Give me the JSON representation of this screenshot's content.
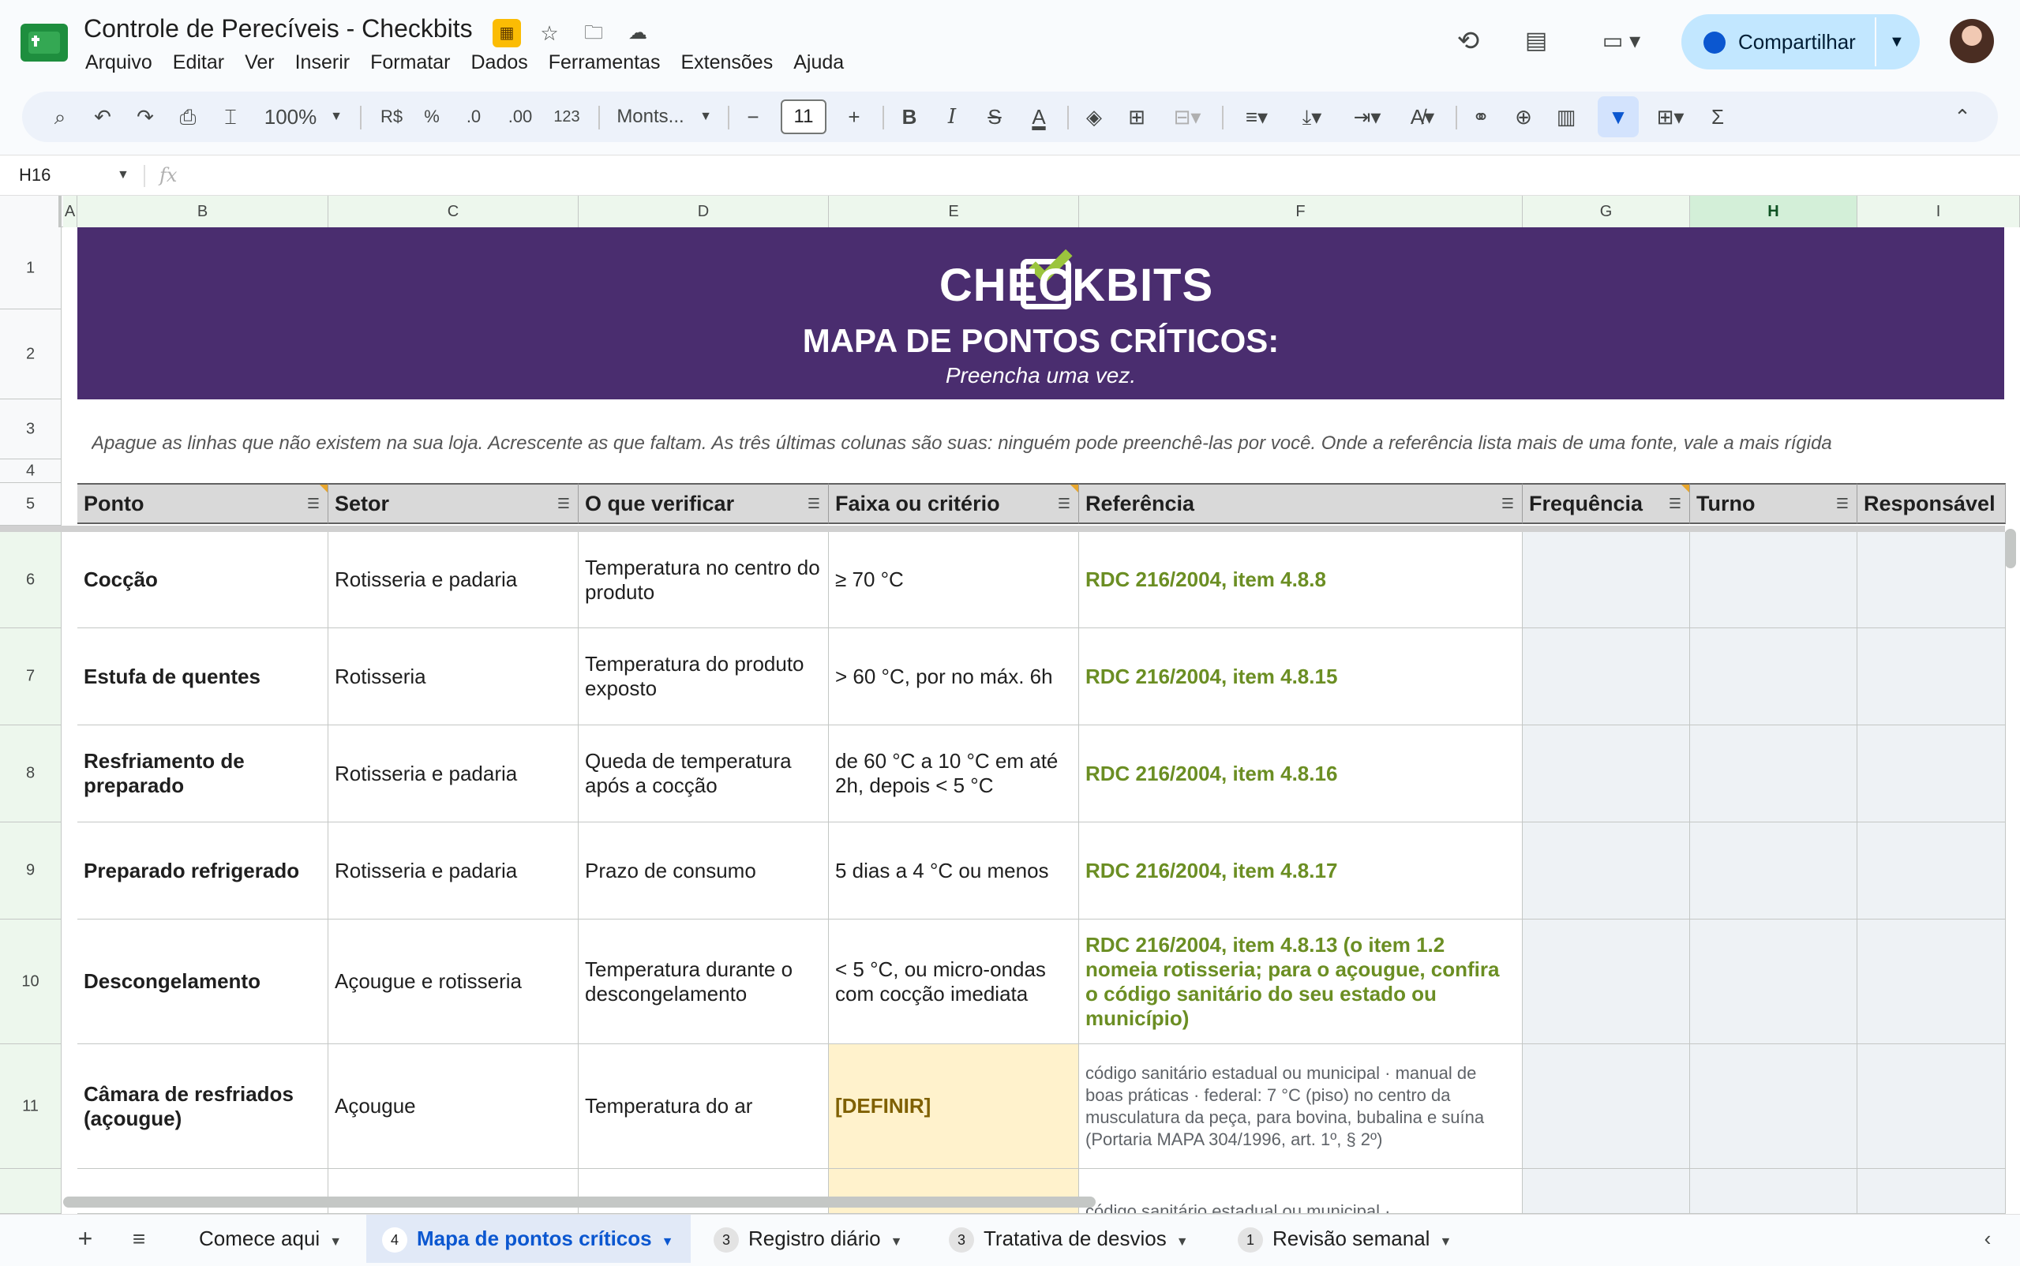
{
  "app": {
    "doc_title": "Controle de Perecíveis - Checkbits",
    "menus": [
      "Arquivo",
      "Editar",
      "Ver",
      "Inserir",
      "Formatar",
      "Dados",
      "Ferramentas",
      "Extensões",
      "Ajuda"
    ],
    "share_label": "Compartilhar"
  },
  "toolbar": {
    "zoom": "100%",
    "currency": "R$",
    "percent": "%",
    "dec_decrease": ".0",
    "dec_increase": ".00",
    "number_format": "123",
    "font": "Monts...",
    "font_size": "11",
    "bold": "B",
    "italic": "I",
    "strike": "S",
    "textcolor": "A",
    "sum": "Σ"
  },
  "formula_bar": {
    "cell_ref": "H16",
    "fx": "fx"
  },
  "columns": [
    "A",
    "B",
    "C",
    "D",
    "E",
    "F",
    "G",
    "H",
    "I"
  ],
  "selected_column": "H",
  "rows": [
    "1",
    "2",
    "3",
    "4",
    "5",
    "6",
    "7",
    "8",
    "9",
    "10",
    "11"
  ],
  "banner": {
    "brand": "CHECKBITS",
    "title": "MAPA DE PONTOS CRÍTICOS:",
    "subtitle": "Preencha uma vez."
  },
  "instructions": "Apague as linhas que não existem na sua loja. Acrescente as que faltam. As três últimas colunas são suas: ninguém pode preenchê-las por você. Onde a referência lista mais de uma fonte, vale a mais rígida",
  "table": {
    "headers": [
      "Ponto",
      "Setor",
      "O que verificar",
      "Faixa ou critério",
      "Referência",
      "Frequência",
      "Turno",
      "Responsável"
    ],
    "rows": [
      {
        "ponto": "Cocção",
        "setor": "Rotisseria e padaria",
        "verificar": "Temperatura no centro do produto",
        "faixa": "≥ 70 °C",
        "ref": "RDC 216/2004, item 4.8.8"
      },
      {
        "ponto": "Estufa de quentes",
        "setor": "Rotisseria",
        "verificar": "Temperatura do produto exposto",
        "faixa": "> 60 °C, por no máx. 6h",
        "ref": "RDC 216/2004, item 4.8.15"
      },
      {
        "ponto": "Resfriamento de preparado",
        "setor": "Rotisseria e padaria",
        "verificar": "Queda de temperatura após a cocção",
        "faixa": "de 60 °C a 10 °C em até 2h, depois < 5 °C",
        "ref": "RDC 216/2004, item 4.8.16"
      },
      {
        "ponto": "Preparado refrigerado",
        "setor": "Rotisseria e padaria",
        "verificar": "Prazo de consumo",
        "faixa": "5 dias a 4 °C ou menos",
        "ref": "RDC 216/2004, item 4.8.17"
      },
      {
        "ponto": "Descongelamento",
        "setor": "Açougue e rotisseria",
        "verificar": "Temperatura durante o descongelamento",
        "faixa": "< 5 °C, ou micro-ondas com cocção imediata",
        "ref": "RDC 216/2004, item 4.8.13 (o item 1.2 nomeia rotisseria; para o açougue, confira o código sanitário do seu estado ou município)"
      },
      {
        "ponto": "Câmara de resfriados (açougue)",
        "setor": "Açougue",
        "verificar": "Temperatura do ar",
        "faixa": "[DEFINIR]",
        "ref": "código sanitário estadual ou municipal · manual de boas práticas · federal: 7 °C (piso) no centro da musculatura da peça, para bovina, bubalina e suína (Portaria MAPA 304/1996, art. 1º, § 2º)"
      }
    ],
    "partial_row_ref": "código sanitário estadual ou municipal ·"
  },
  "sheets": [
    {
      "label": "Comece aqui",
      "badge": ""
    },
    {
      "label": "Mapa de pontos críticos",
      "badge": "4",
      "active": true
    },
    {
      "label": "Registro diário",
      "badge": "3"
    },
    {
      "label": "Tratativa de desvios",
      "badge": "3"
    },
    {
      "label": "Revisão semanal",
      "badge": "1"
    }
  ],
  "colors": {
    "banner": "#4a2d6f",
    "reference_green": "#6b8e23",
    "tbd_fill": "#fff2cc",
    "share_button": "#c2e7ff"
  }
}
